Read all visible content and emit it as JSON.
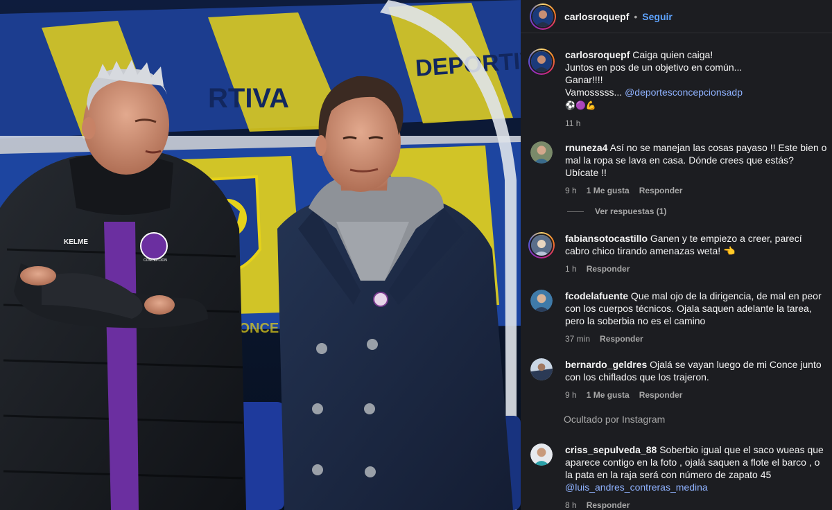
{
  "post": {
    "author": "carlosroquepf",
    "separator": "•",
    "follow_label": "Seguir",
    "caption_user": "carlosroquepf",
    "caption_lines": [
      "Caiga quien caiga!",
      "Juntos en pos de un objetivo en común...",
      "Ganar!!!!"
    ],
    "caption_vamos": "Vamosssss...",
    "caption_mention": "@deportesconcepcionsadp",
    "caption_emojis": "⚽🟣💪",
    "caption_time": "11 h"
  },
  "photo": {
    "jacket_brand": "KELME",
    "crest_text": "CONCEPCION",
    "banner_text_1": "RTIVA",
    "banner_text_2": "DEPORTIVA",
    "banner_text_3": "CONCEPCION"
  },
  "comments": [
    {
      "user": "rnuneza4",
      "text": "Así no se manejan las cosas payaso !! Este bien o mal la ropa se lava en casa. Dónde crees que estás? Ubícate !!",
      "time": "9 h",
      "likes": "1 Me gusta",
      "reply": "Responder"
    },
    {
      "user": "fabiansotocastillo",
      "text": "Ganen y te empiezo a creer, parecí cabro chico tirando amenazas weta! 👈",
      "time": "1 h",
      "reply": "Responder"
    },
    {
      "user": "fcodelafuente",
      "text": "Que mal ojo de la dirigencia, de mal en peor con los cuerpos técnicos. Ojala saquen adelante la tarea, pero la soberbia no es el camino",
      "time": "37 min",
      "reply": "Responder"
    },
    {
      "user": "bernardo_geldres",
      "text": "Ojalá se vayan luego de mi Conce junto con los chiflados que los trajeron.",
      "time": "9 h",
      "likes": "1 Me gusta",
      "reply": "Responder"
    },
    {
      "user": "criss_sepulveda_88",
      "text": "Soberbio igual que el saco wueas que aparece contigo en la foto , ojalá saquen a flote el barco , o la pata en la raja será con número de zapato 45",
      "mention": "@luis_andres_contreras_medina",
      "time": "8 h",
      "reply": "Responder"
    }
  ],
  "view_replies": "Ver respuestas (1)",
  "hidden_note": "Ocultado por Instagram",
  "colors": {
    "panel_bg": "#1c1d21",
    "link_blue": "#5ea3ff",
    "mention_blue": "#8fb2ff",
    "muted": "#a8a8a8",
    "stadium_blue": "#1c3d8f",
    "stadium_yellow": "#e6d21a",
    "club_purple": "#6b2fa0"
  },
  "icons": [
    "avatar-image",
    "avatar-image",
    "avatar-image",
    "avatar-image",
    "avatar-image",
    "avatar-image"
  ]
}
